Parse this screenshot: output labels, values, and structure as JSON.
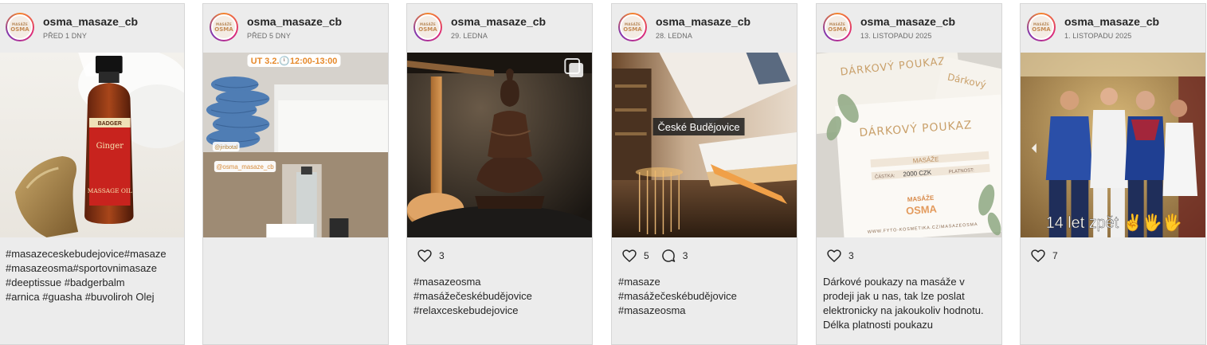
{
  "posts": [
    {
      "username": "osma_masaze_cb",
      "date": "PŘED 1 DNY",
      "avatar": {
        "top": "MASÁŽE",
        "bottom": "OSMA"
      },
      "image_text": {
        "brand": "BADGER",
        "product": "Ginger",
        "sub": "MASSAGE OIL"
      },
      "likes": null,
      "comments": null,
      "caption_lines": [
        "#masazeceskebudejovice#masaze",
        "#masazeosma#sportovnimasaze",
        "#deeptissue #badgerbalm",
        "#arnica #guasha #buvoliroh Olej"
      ]
    },
    {
      "username": "osma_masaze_cb",
      "date": "PŘED 5 DNY",
      "avatar": {
        "top": "MASÁŽE",
        "bottom": "OSMA"
      },
      "image_text": {
        "time": "UT 3.2.🕛12:00-13:00",
        "tag1": "@jiribotal",
        "tag2": "@osma_masaze_cb"
      },
      "likes": null,
      "comments": null,
      "caption_lines": []
    },
    {
      "username": "osma_masaze_cb",
      "date": "29. LEDNA",
      "avatar": {
        "top": "MASÁŽE",
        "bottom": "OSMA"
      },
      "image_text": {},
      "likes": "3",
      "comments": null,
      "caption_lines": [
        "#masazeosma",
        "#masážečeskébudějovice",
        "#relaxceskebudejovice"
      ]
    },
    {
      "username": "osma_masaze_cb",
      "date": "28. LEDNA",
      "avatar": {
        "top": "MASÁŽE",
        "bottom": "OSMA"
      },
      "image_text": {
        "location": "České Budějovice"
      },
      "likes": "5",
      "comments": "3",
      "caption_lines": [
        "#masaze",
        "#masážečeskébudějovice",
        "#masazeosma"
      ]
    },
    {
      "username": "osma_masaze_cb",
      "date": "13. LISTOPADU 2025",
      "avatar": {
        "top": "MASÁŽE",
        "bottom": "OSMA"
      },
      "image_text": {
        "voucher1": "DÁRKOVÝ POUKAZ",
        "voucher2": "DÁRKOVÝ POUKAZ",
        "voucher_top": "Dárkový",
        "field_type": "MASÁŽE",
        "amount_label": "ČÁSTKA:",
        "amount": "2000 CZK",
        "validity": "PLATNOST:",
        "logo_top": "MASÁŽE",
        "logo_bottom": "OSMA",
        "url": "WWW.FYTO-KOSMETIKA.CZ/MASAZEOSMA"
      },
      "likes": "3",
      "comments": null,
      "caption_lines": [
        "Dárkové poukazy na masáže v prodeji jak u nas, tak lze poslat elektronicky na jakoukoliv hodnotu. Délka platnosti poukazu"
      ]
    },
    {
      "username": "osma_masaze_cb",
      "date": "1. LISTOPADU 2025",
      "avatar": {
        "top": "MASÁŽE",
        "bottom": "OSMA"
      },
      "image_text": {
        "overlay": "14 let zpět ✌🖐🖐"
      },
      "likes": "7",
      "comments": null,
      "caption_lines": []
    }
  ],
  "colors": {
    "card_bg": "#ececec",
    "text": "#262626",
    "muted": "#6b6b6b",
    "border": "#d6d6d6"
  },
  "icons": {
    "like": "heart-icon",
    "comment": "comment-icon",
    "carousel": "carousel-icon"
  }
}
